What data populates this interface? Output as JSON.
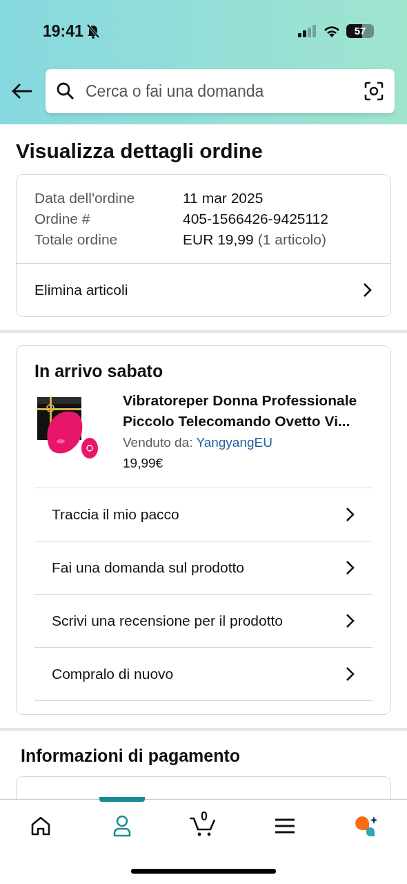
{
  "status_bar": {
    "time": "19:41",
    "battery": "57"
  },
  "search": {
    "placeholder": "Cerca o fai una domanda"
  },
  "page_title": "Visualizza dettagli ordine",
  "order_summary": {
    "rows": [
      {
        "label": "Data dell'ordine",
        "value": "11 mar 2025"
      },
      {
        "label": "Ordine #",
        "value": "405-1566426-9425112"
      },
      {
        "label": "Totale ordine",
        "value": "EUR 19,99",
        "note": "(1 articolo)"
      }
    ],
    "action": "Elimina articoli"
  },
  "shipment": {
    "heading": "In arrivo sabato",
    "product": {
      "kind": "picture",
      "title": "Vibratoreper Donna Professionale Piccolo Telecomando Ovetto Vi...",
      "seller_label": "Venduto da:",
      "seller": "YangyangEU",
      "price": "19,99€"
    },
    "actions": [
      "Traccia il mio pacco",
      "Fai una domanda sul prodotto",
      "Scrivi una recensione per il prodotto",
      "Compralo di nuovo"
    ]
  },
  "payment": {
    "heading": "Informazioni di pagamento"
  },
  "bottom_nav": [
    {
      "kind": "home",
      "selected": false
    },
    {
      "kind": "account",
      "selected": true
    },
    {
      "kind": "cart",
      "selected": false,
      "count": "0"
    },
    {
      "kind": "menu",
      "selected": false
    },
    {
      "kind": "assistant",
      "selected": false
    }
  ]
}
